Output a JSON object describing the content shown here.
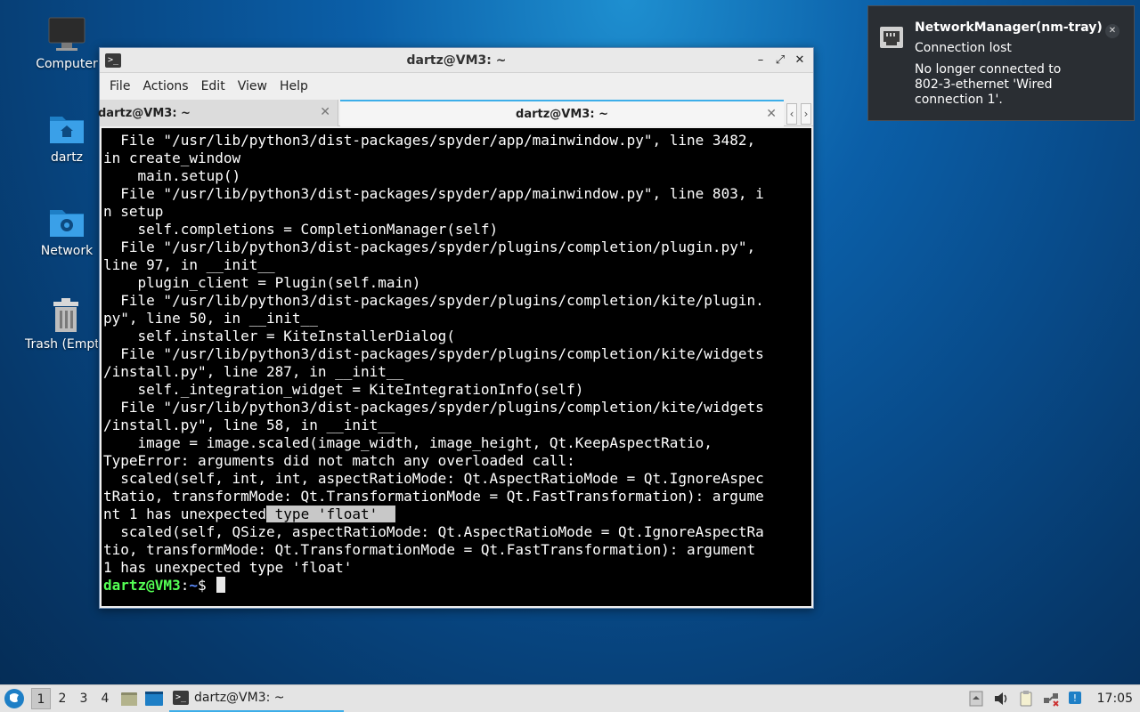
{
  "desktop": {
    "icons": [
      {
        "label": "Computer"
      },
      {
        "label": "dartz"
      },
      {
        "label": "Network"
      },
      {
        "label": "Trash (Empty)"
      }
    ]
  },
  "window": {
    "title": "dartz@VM3: ~",
    "menu": [
      "File",
      "Actions",
      "Edit",
      "View",
      "Help"
    ],
    "tabs": [
      {
        "label": "dartz@VM3: ~",
        "active": false
      },
      {
        "label": "dartz@VM3: ~",
        "active": true
      }
    ],
    "terminal": {
      "lines": [
        "  File \"/usr/lib/python3/dist-packages/spyder/app/mainwindow.py\", line 3482,",
        "in create_window",
        "    main.setup()",
        "  File \"/usr/lib/python3/dist-packages/spyder/app/mainwindow.py\", line 803, i",
        "n setup",
        "    self.completions = CompletionManager(self)",
        "  File \"/usr/lib/python3/dist-packages/spyder/plugins/completion/plugin.py\",",
        "line 97, in __init__",
        "    plugin_client = Plugin(self.main)",
        "  File \"/usr/lib/python3/dist-packages/spyder/plugins/completion/kite/plugin.",
        "py\", line 50, in __init__",
        "    self.installer = KiteInstallerDialog(",
        "  File \"/usr/lib/python3/dist-packages/spyder/plugins/completion/kite/widgets",
        "/install.py\", line 287, in __init__",
        "    self._integration_widget = KiteIntegrationInfo(self)",
        "  File \"/usr/lib/python3/dist-packages/spyder/plugins/completion/kite/widgets",
        "/install.py\", line 58, in __init__",
        "    image = image.scaled(image_width, image_height, Qt.KeepAspectRatio,",
        "TypeError: arguments did not match any overloaded call:",
        "  scaled(self, int, int, aspectRatioMode: Qt.AspectRatioMode = Qt.IgnoreAspec",
        "tRatio, transformMode: Qt.TransformationMode = Qt.FastTransformation): argume"
      ],
      "highlight_line": {
        "before": "nt 1 has unexpected",
        "selected": " type 'float'  "
      },
      "lines_after": [
        "  scaled(self, QSize, aspectRatioMode: Qt.AspectRatioMode = Qt.IgnoreAspectRa",
        "tio, transformMode: Qt.TransformationMode = Qt.FastTransformation): argument",
        "1 has unexpected type 'float'"
      ],
      "prompt": {
        "user_host": "dartz@VM3",
        "separator": ":",
        "path": "~",
        "symbol": "$ "
      }
    }
  },
  "notification": {
    "app": "NetworkManager(nm-tray)",
    "summary": "Connection lost",
    "body": "No longer connected to 802-3-ethernet 'Wired connection 1'."
  },
  "taskbar": {
    "workspaces": [
      "1",
      "2",
      "3",
      "4"
    ],
    "active_workspace": "1",
    "task_label": "dartz@VM3: ~",
    "clock": "17:05"
  }
}
